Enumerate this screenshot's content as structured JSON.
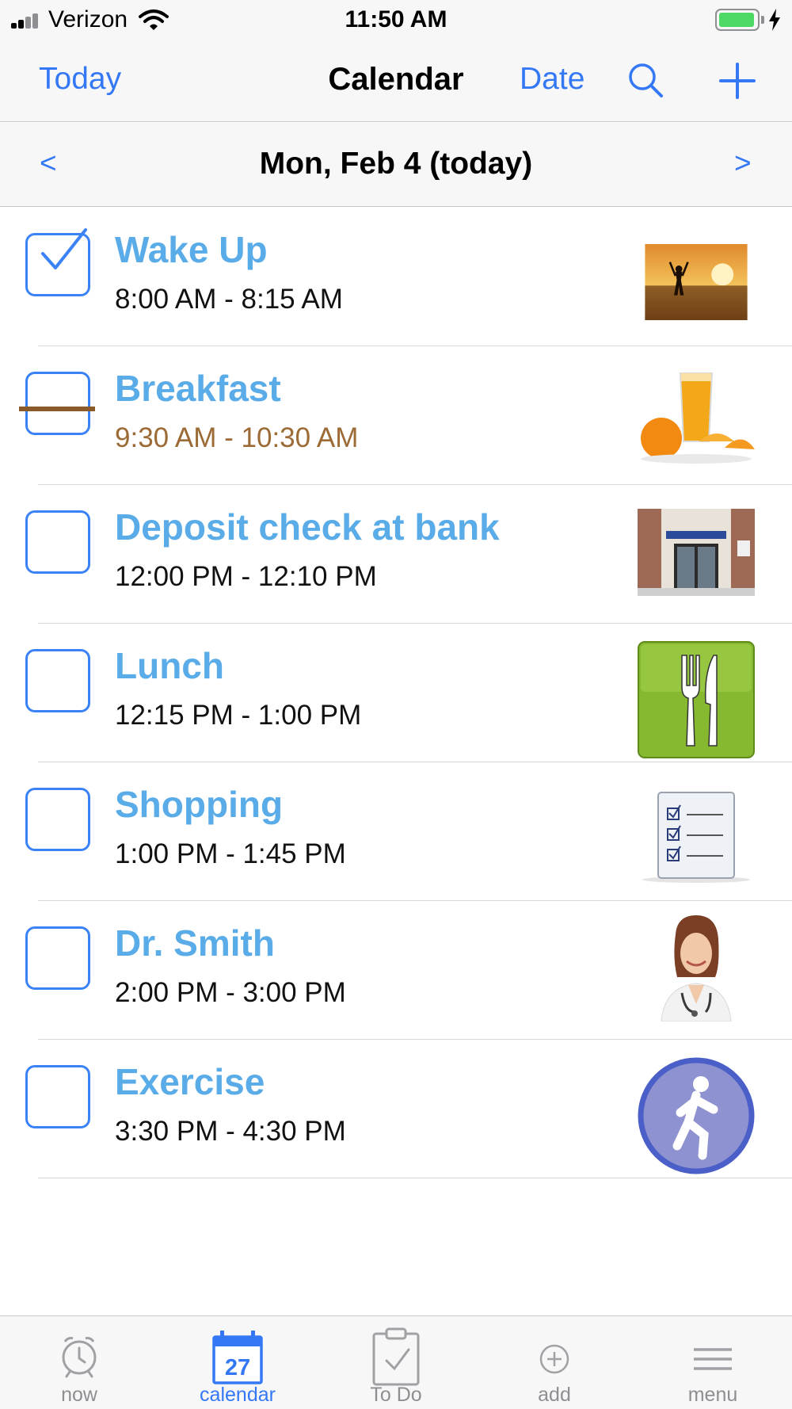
{
  "status_bar": {
    "carrier": "Verizon",
    "time": "11:50 AM",
    "battery_level": 0.95
  },
  "nav": {
    "left_button": "Today",
    "title": "Calendar",
    "right_button": "Date",
    "search_icon": "magnifier-icon",
    "add_icon": "plus-icon"
  },
  "date_bar": {
    "prev": "<",
    "label": "Mon, Feb 4 (today)",
    "next": ">"
  },
  "events": [
    {
      "title": "Wake Up",
      "time": "8:00 AM - 8:15 AM",
      "checked": true,
      "thumb": "sunrise-beach-photo"
    },
    {
      "title": "Breakfast",
      "time": "9:30 AM - 10:30 AM",
      "checked": false,
      "current": true,
      "thumb": "orange-juice-photo"
    },
    {
      "title": "Deposit check at bank",
      "time": "12:00 PM - 12:10 PM",
      "checked": false,
      "thumb": "bank-entrance-photo"
    },
    {
      "title": "Lunch",
      "time": "12:15 PM - 1:00 PM",
      "checked": false,
      "thumb": "fork-knife-icon"
    },
    {
      "title": "Shopping",
      "time": "1:00 PM - 1:45 PM",
      "checked": false,
      "thumb": "checklist-icon"
    },
    {
      "title": "Dr. Smith",
      "time": "2:00 PM - 3:00 PM",
      "checked": false,
      "thumb": "doctor-photo"
    },
    {
      "title": "Exercise",
      "time": "3:30 PM - 4:30 PM",
      "checked": false,
      "thumb": "running-person-icon"
    }
  ],
  "tabs": [
    {
      "label": "now",
      "icon": "alarm-clock-icon",
      "active": false
    },
    {
      "label": "calendar",
      "icon": "calendar-icon",
      "badge": "27",
      "active": true
    },
    {
      "label": "To Do",
      "icon": "clipboard-check-icon",
      "active": false
    },
    {
      "label": "add",
      "icon": "plus-circle-icon",
      "active": false
    },
    {
      "label": "menu",
      "icon": "hamburger-icon",
      "active": false
    }
  ],
  "colors": {
    "accent": "#3478f6",
    "event_title": "#5aace8",
    "current_time": "#9b6a35",
    "checkbox": "#3b82f6"
  }
}
